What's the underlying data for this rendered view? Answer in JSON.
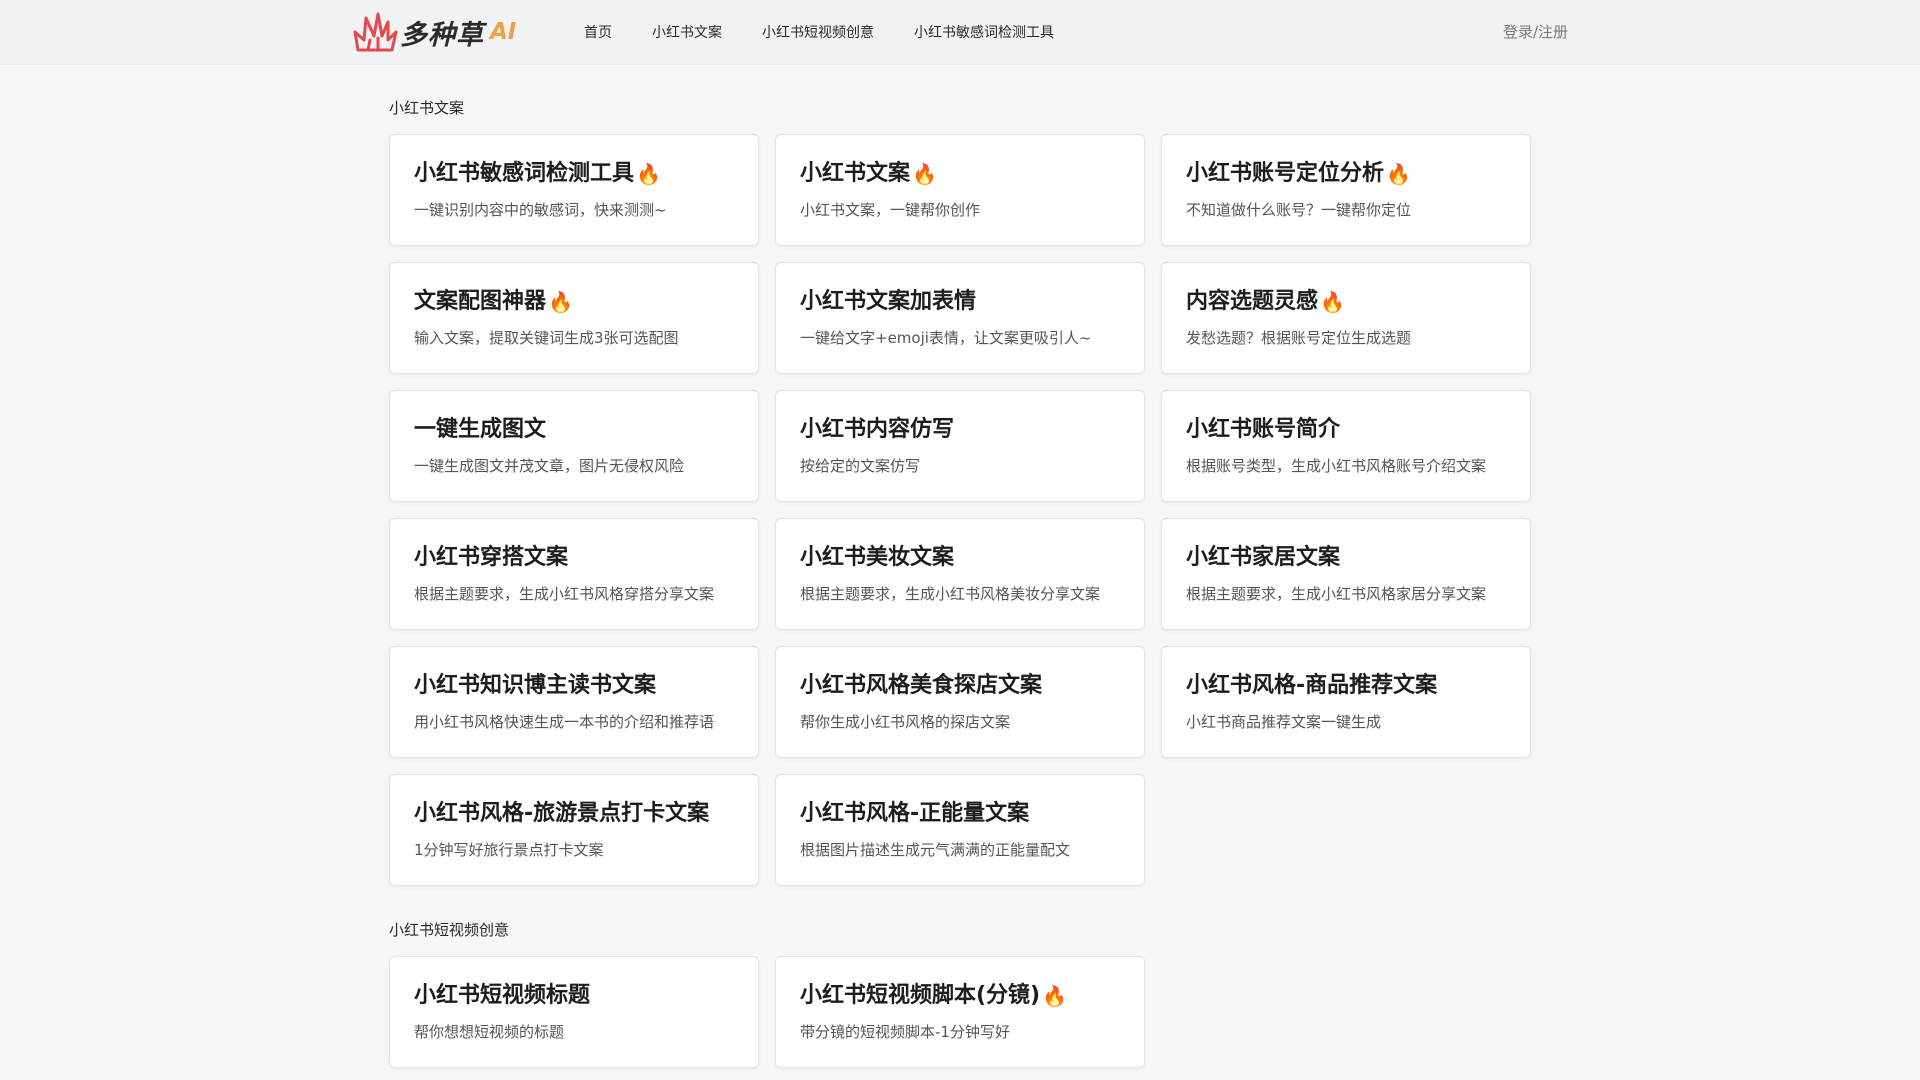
{
  "brand": {
    "name": "多种草",
    "suffix": "AI"
  },
  "nav": {
    "items": [
      {
        "label": "首页"
      },
      {
        "label": "小红书文案"
      },
      {
        "label": "小红书短视频创意"
      },
      {
        "label": "小红书敏感词检测工具"
      }
    ],
    "login_label": "登录/注册"
  },
  "sections": [
    {
      "title": "小红书文案",
      "cards": [
        {
          "title": "小红书敏感词检测工具",
          "hot": true,
          "desc": "一键识别内容中的敏感词，快来测测~"
        },
        {
          "title": "小红书文案",
          "hot": true,
          "desc": "小红书文案，一键帮你创作"
        },
        {
          "title": "小红书账号定位分析",
          "hot": true,
          "desc": "不知道做什么账号？一键帮你定位"
        },
        {
          "title": "文案配图神器",
          "hot": true,
          "desc": "输入文案，提取关键词生成3张可选配图"
        },
        {
          "title": "小红书文案加表情",
          "hot": false,
          "desc": "一键给文字+emoji表情，让文案更吸引人~"
        },
        {
          "title": "内容选题灵感",
          "hot": true,
          "desc": "发愁选题？根据账号定位生成选题"
        },
        {
          "title": "一键生成图文",
          "hot": false,
          "desc": "一键生成图文并茂文章，图片无侵权风险"
        },
        {
          "title": "小红书内容仿写",
          "hot": false,
          "desc": "按给定的文案仿写"
        },
        {
          "title": "小红书账号简介",
          "hot": false,
          "desc": "根据账号类型，生成小红书风格账号介绍文案"
        },
        {
          "title": "小红书穿搭文案",
          "hot": false,
          "desc": "根据主题要求，生成小红书风格穿搭分享文案"
        },
        {
          "title": "小红书美妆文案",
          "hot": false,
          "desc": "根据主题要求，生成小红书风格美妆分享文案"
        },
        {
          "title": "小红书家居文案",
          "hot": false,
          "desc": "根据主题要求，生成小红书风格家居分享文案"
        },
        {
          "title": "小红书知识博主读书文案",
          "hot": false,
          "desc": "用小红书风格快速生成一本书的介绍和推荐语"
        },
        {
          "title": "小红书风格美食探店文案",
          "hot": false,
          "desc": "帮你生成小红书风格的探店文案"
        },
        {
          "title": "小红书风格-商品推荐文案",
          "hot": false,
          "desc": "小红书商品推荐文案一键生成"
        },
        {
          "title": "小红书风格-旅游景点打卡文案",
          "hot": false,
          "desc": "1分钟写好旅行景点打卡文案"
        },
        {
          "title": "小红书风格-正能量文案",
          "hot": false,
          "desc": "根据图片描述生成元气满满的正能量配文"
        }
      ]
    },
    {
      "title": "小红书短视频创意",
      "cards": [
        {
          "title": "小红书短视频标题",
          "hot": false,
          "desc": "帮你想想短视频的标题"
        },
        {
          "title": "小红书短视频脚本(分镜)",
          "hot": true,
          "desc": "带分镜的短视频脚本-1分钟写好"
        }
      ]
    }
  ],
  "hot_icon": "🔥",
  "colors": {
    "accent": "#e9a24a",
    "logo_mark": "#e5484d"
  }
}
